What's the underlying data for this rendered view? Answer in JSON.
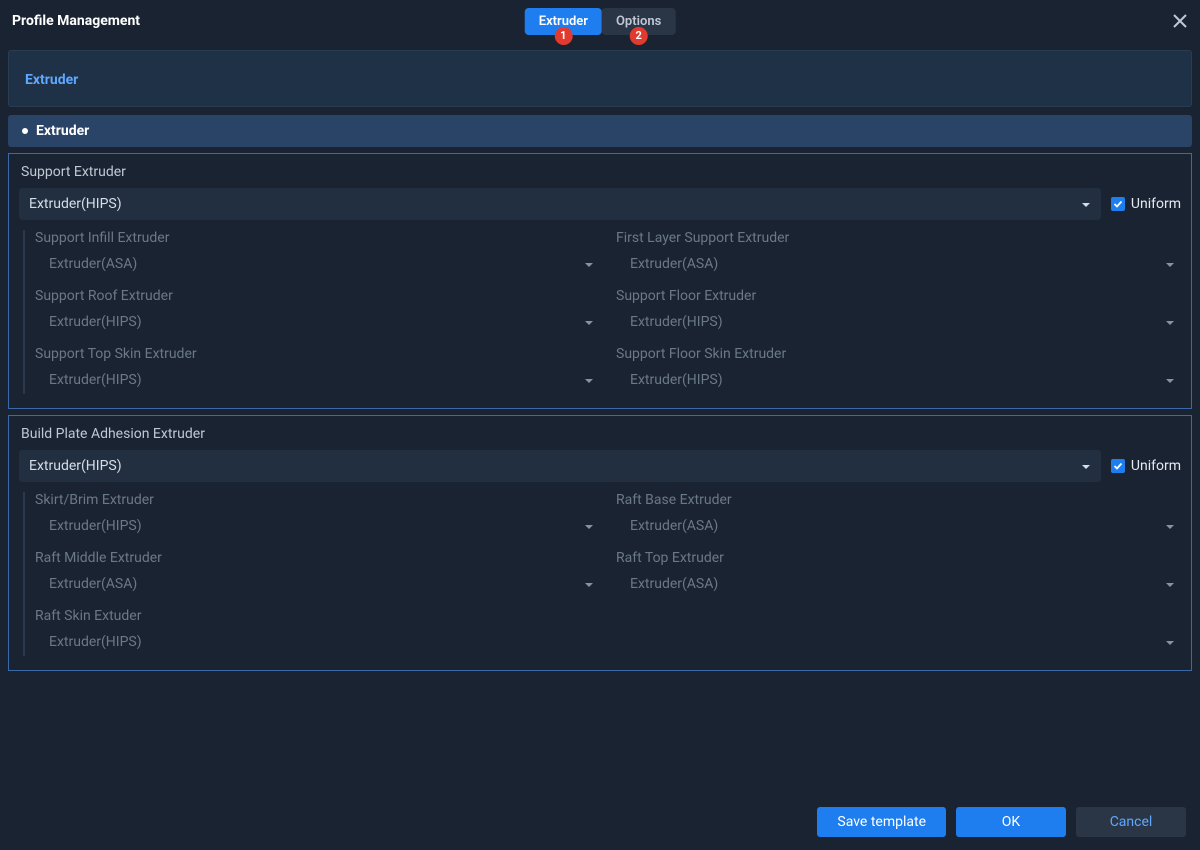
{
  "title": "Profile Management",
  "tabs": {
    "extruder": {
      "label": "Extruder",
      "badge": "1"
    },
    "options": {
      "label": "Options",
      "badge": "2"
    }
  },
  "breadcrumb": "Extruder",
  "section": {
    "title": "Extruder"
  },
  "uniform_label": "Uniform",
  "groups": {
    "support": {
      "title": "Support Extruder",
      "primary": "Extruder(HIPS)",
      "uniform": true,
      "fields": {
        "infill": {
          "label": "Support Infill Extruder",
          "value": "Extruder(ASA)"
        },
        "first_layer": {
          "label": "First Layer Support Extruder",
          "value": "Extruder(ASA)"
        },
        "roof": {
          "label": "Support Roof Extruder",
          "value": "Extruder(HIPS)"
        },
        "floor": {
          "label": "Support Floor Extruder",
          "value": "Extruder(HIPS)"
        },
        "top_skin": {
          "label": "Support Top Skin Extruder",
          "value": "Extruder(HIPS)"
        },
        "floor_skin": {
          "label": "Support Floor Skin Extruder",
          "value": "Extruder(HIPS)"
        }
      }
    },
    "adhesion": {
      "title": "Build Plate Adhesion Extruder",
      "primary": "Extruder(HIPS)",
      "uniform": true,
      "fields": {
        "skirt_brim": {
          "label": "Skirt/Brim Extruder",
          "value": "Extruder(HIPS)"
        },
        "raft_base": {
          "label": "Raft Base Extruder",
          "value": "Extruder(ASA)"
        },
        "raft_middle": {
          "label": "Raft Middle Extruder",
          "value": "Extruder(ASA)"
        },
        "raft_top": {
          "label": "Raft Top Extruder",
          "value": "Extruder(ASA)"
        },
        "raft_skin": {
          "label": "Raft Skin Extuder",
          "value": "Extruder(HIPS)"
        }
      }
    }
  },
  "footer": {
    "save_template": "Save template",
    "ok": "OK",
    "cancel": "Cancel"
  }
}
